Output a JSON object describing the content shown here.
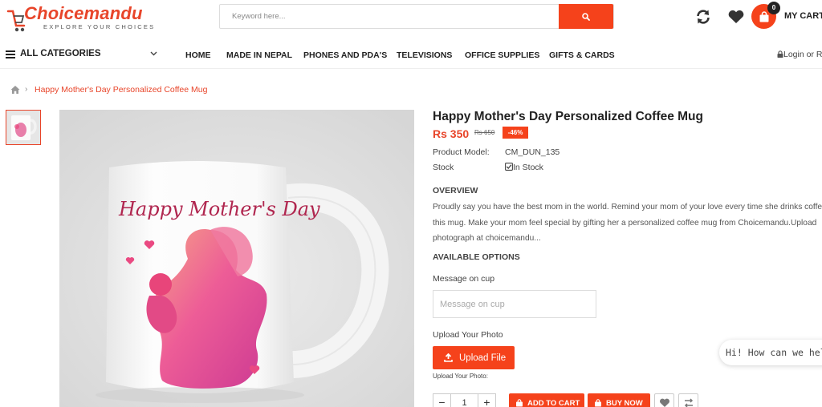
{
  "brand": {
    "name": "Choicemandu",
    "tagline": "EXPLORE YOUR CHOICES"
  },
  "search": {
    "placeholder": "Keyword here..."
  },
  "header": {
    "cart_count": "0",
    "cart_label": "MY CART"
  },
  "nav": {
    "all_categories": "ALL CATEGORIES",
    "items": [
      "HOME",
      "MADE IN NEPAL",
      "PHONES AND PDA'S",
      "TELEVISIONS",
      "OFFICE SUPPLIES",
      "GIFTS & CARDS"
    ],
    "login": "Login or R"
  },
  "breadcrumb": {
    "current": "Happy Mother's Day Personalized Coffee Mug"
  },
  "image": {
    "mug_text": "Happy Mother's Day"
  },
  "product": {
    "title": "Happy Mother's Day Personalized Coffee Mug",
    "price": "Rs 350",
    "old_price": "Rs 650",
    "discount": "-46%",
    "model_label": "Product Model:",
    "model_value": "CM_DUN_135",
    "stock_label": "Stock",
    "stock_value": "In Stock",
    "overview_heading": "OVERVIEW",
    "overview_lines": [
      "Proudly say you have the best mom in the world. Remind your mom of your love every time she drinks coffee",
      "this mug. Make your mom feel special by gifting her a personalized coffee mug from Choicemandu.Upload",
      "photograph at choicemandu..."
    ],
    "options_heading": "AVAILABLE OPTIONS",
    "message_label": "Message on cup",
    "message_placeholder": "Message on cup",
    "upload_label": "Upload Your Photo",
    "upload_button": "Upload File",
    "upload_note": "Upload Your Photo:",
    "quantity": "1",
    "add_to_cart": "ADD TO CART",
    "buy_now": "BUY NOW"
  },
  "chat": {
    "text": "Hi! How can we help y"
  },
  "colors": {
    "accent": "#f5421b",
    "brand": "#e8452a"
  }
}
